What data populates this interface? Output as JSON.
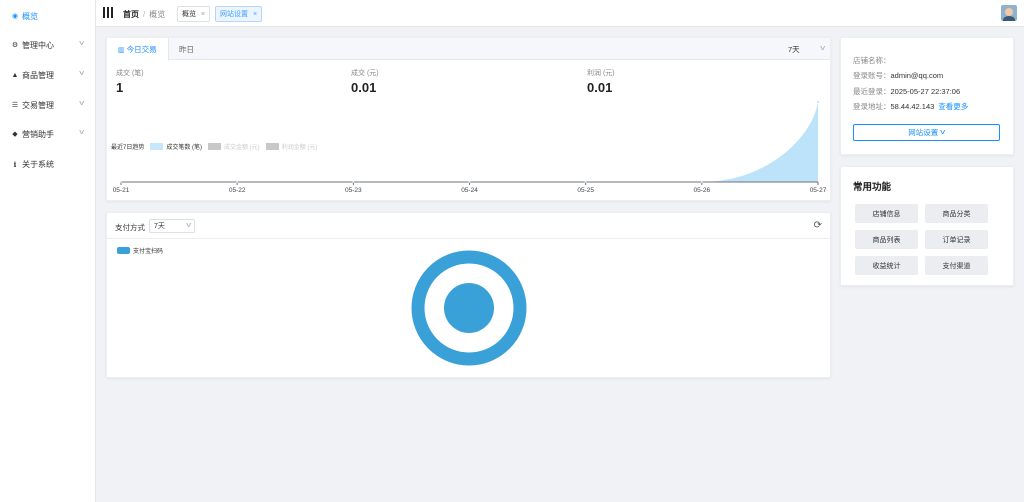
{
  "colors": {
    "accent": "#1890ff",
    "chart_fill": "#bde3fa",
    "donut": "#3aa0d8",
    "legend_off": "#c8c8c8"
  },
  "sidebar": {
    "items": [
      {
        "label": "概览",
        "icon": "dashboard-icon",
        "active": true
      },
      {
        "label": "管理中心",
        "icon": "gears-icon",
        "chevron": true
      },
      {
        "label": "商品管理",
        "icon": "cubes-icon",
        "chevron": true
      },
      {
        "label": "交易管理",
        "icon": "list-icon",
        "chevron": true
      },
      {
        "label": "营销助手",
        "icon": "tag-icon",
        "chevron": true
      },
      {
        "label": "关于系统",
        "icon": "info-icon"
      }
    ]
  },
  "header": {
    "breadcrumb": {
      "home": "首页",
      "separator": "/",
      "current": "概览"
    },
    "tabs": [
      {
        "label": "概览",
        "close": "×"
      },
      {
        "label": "网站设置",
        "close": "×"
      }
    ]
  },
  "trade": {
    "tabs": [
      "今日交易",
      "昨日"
    ],
    "range": "7天",
    "stats": [
      {
        "label": "成交 (笔)",
        "value": "1"
      },
      {
        "label": "成交 (元)",
        "value": "0.01"
      },
      {
        "label": "利润 (元)",
        "value": "0.01"
      }
    ],
    "trend_title": "最近7日趋势",
    "legend": [
      "成交笔数 (笔)",
      "成交金额 (元)",
      "利润金额 (元)"
    ]
  },
  "chart_data": {
    "type": "area",
    "x": [
      "05-21",
      "05-22",
      "05-23",
      "05-24",
      "05-25",
      "05-26",
      "05-27"
    ],
    "series": [
      {
        "name": "成交笔数 (笔)",
        "values": [
          0,
          0,
          0,
          0,
          0,
          0,
          1
        ]
      },
      {
        "name": "成交金额 (元)",
        "values": [
          0,
          0,
          0,
          0,
          0,
          0,
          0.01
        ]
      },
      {
        "name": "利润金额 (元)",
        "values": [
          0,
          0,
          0,
          0,
          0,
          0,
          0.01
        ]
      }
    ],
    "ylim": [
      0,
      1
    ],
    "grid": false,
    "legend_position": "top-left"
  },
  "payment": {
    "title": "支付方式",
    "range": "7天",
    "legend": "支付宝扫码",
    "slices": [
      {
        "name": "支付宝扫码",
        "value": 1
      }
    ]
  },
  "info": {
    "shop_name_label": "店铺名称：",
    "shop_name": "",
    "account_label": "登录账号：",
    "account": "admin@qq.com",
    "last_login_label": "最近登录：",
    "last_login": "2025-05-27 22:37:06",
    "address_label": "登录地址：",
    "address": "58.44.42.143",
    "more_link": "查看更多",
    "site_button": "网站设置"
  },
  "functions": {
    "title": "常用功能",
    "buttons": [
      "店铺信息",
      "商品分类",
      "商品列表",
      "订单记录",
      "收益统计",
      "支付渠道"
    ]
  }
}
